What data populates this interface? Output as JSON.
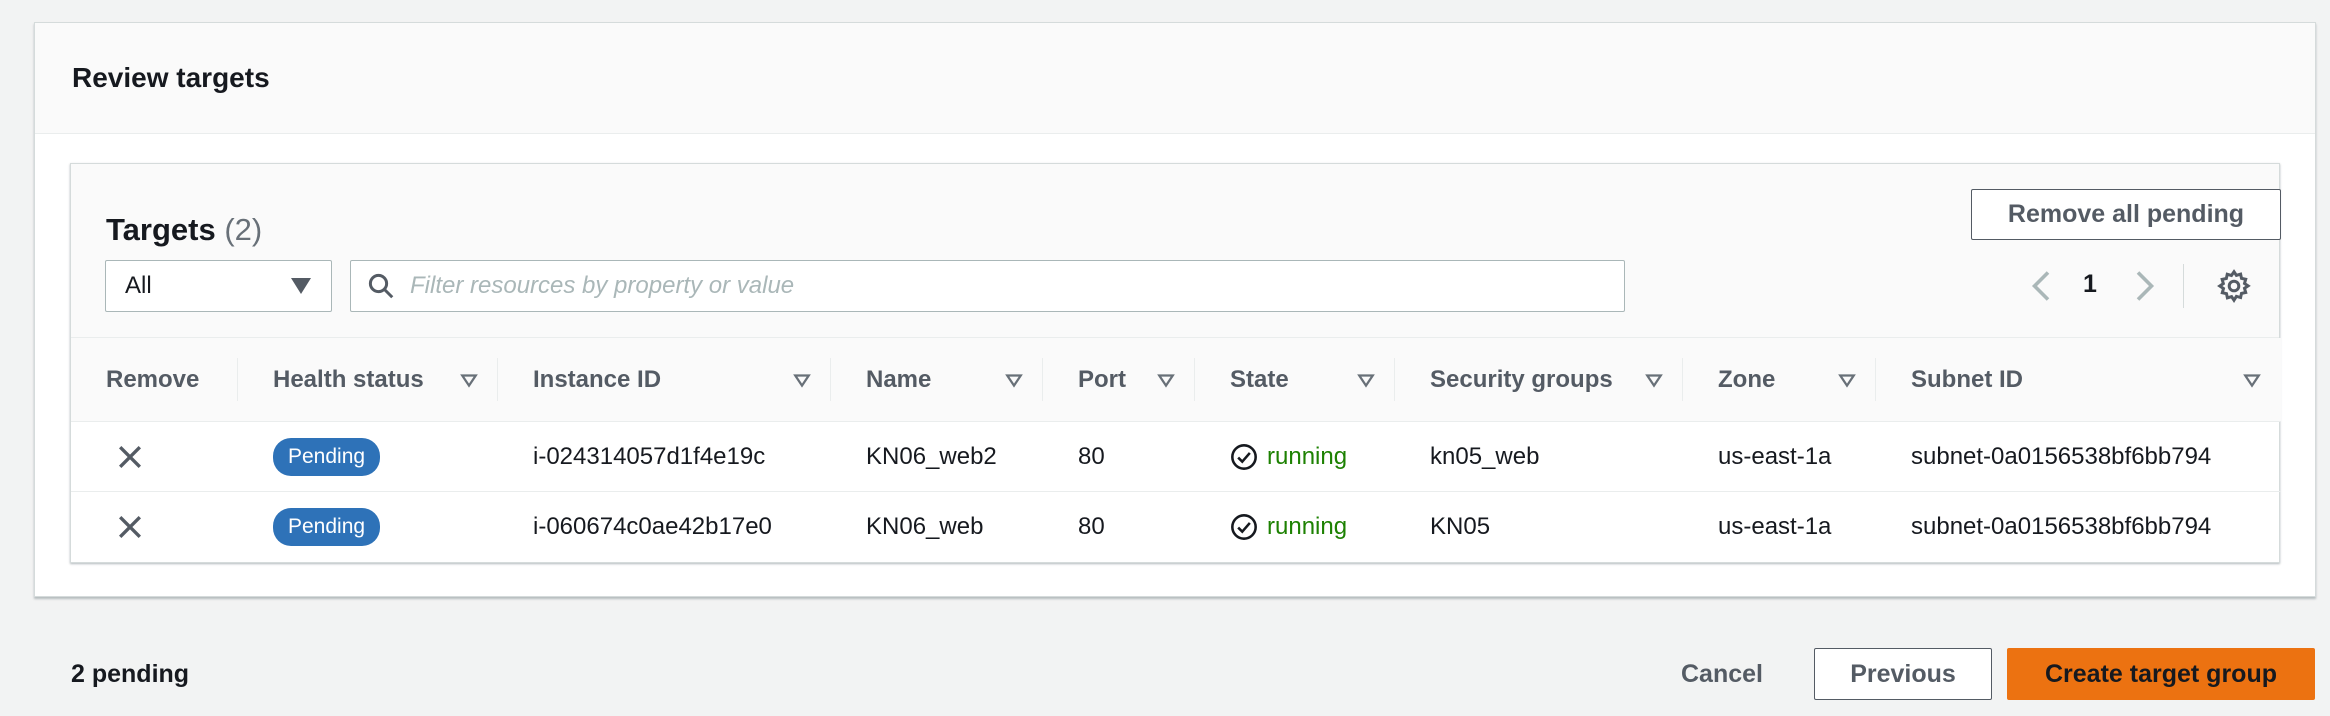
{
  "section": {
    "title": "Review targets"
  },
  "targets": {
    "title": "Targets",
    "count": "(2)",
    "remove_all_label": "Remove all pending",
    "filter_select": "All",
    "search_placeholder": "Filter resources by property or value",
    "page": "1"
  },
  "table": {
    "headers": [
      "Remove",
      "Health status",
      "Instance ID",
      "Name",
      "Port",
      "State",
      "Security groups",
      "Zone",
      "Subnet ID"
    ],
    "rows": [
      {
        "health": "Pending",
        "instance_id": "i-024314057d1f4e19c",
        "name": "KN06_web2",
        "port": "80",
        "state": "running",
        "security_groups": "kn05_web",
        "zone": "us-east-1a",
        "subnet_id": "subnet-0a0156538bf6bb794"
      },
      {
        "health": "Pending",
        "instance_id": "i-060674c0ae42b17e0",
        "name": "KN06_web",
        "port": "80",
        "state": "running",
        "security_groups": "KN05",
        "zone": "us-east-1a",
        "subnet_id": "subnet-0a0156538bf6bb794"
      }
    ]
  },
  "footer": {
    "pending_text": "2 pending",
    "cancel_label": "Cancel",
    "previous_label": "Previous",
    "create_label": "Create target group"
  },
  "colors": {
    "primary": "#ec7211",
    "badge": "#2e72b8",
    "running": "#1d8102"
  },
  "icons": [
    "search-icon",
    "chevron-left-icon",
    "chevron-right-icon",
    "gear-icon",
    "sort-icon",
    "close-icon",
    "check-circle-icon",
    "caret-down-icon"
  ]
}
